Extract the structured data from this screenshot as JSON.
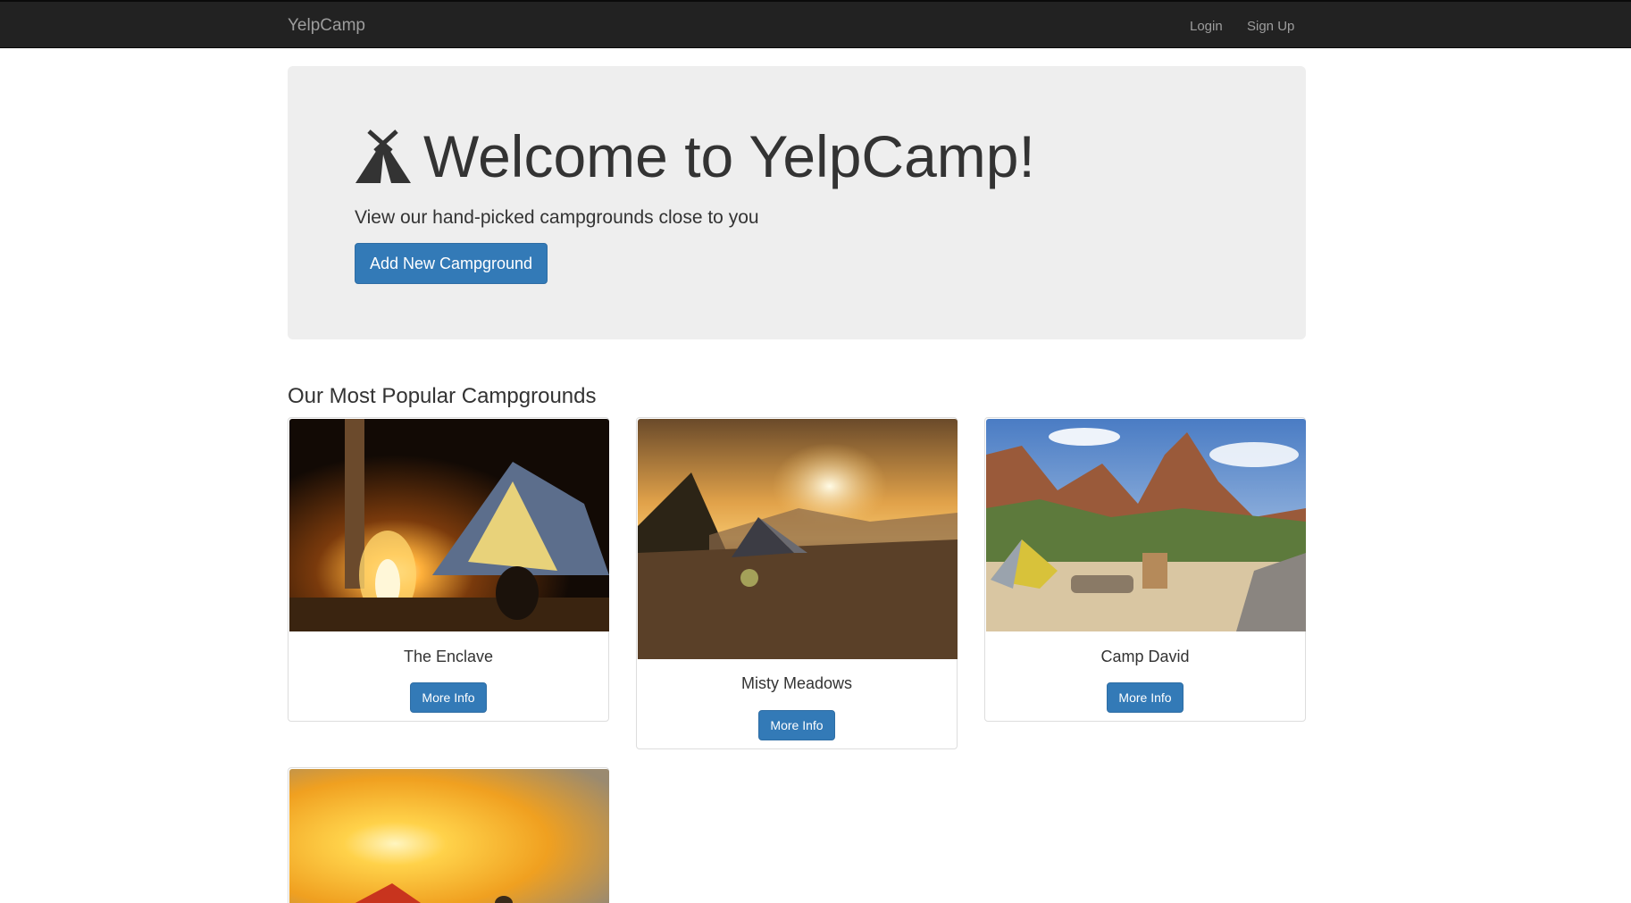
{
  "navbar": {
    "brand": "YelpCamp",
    "links": [
      {
        "label": "Login"
      },
      {
        "label": "Sign Up"
      }
    ]
  },
  "hero": {
    "icon": "tent-icon",
    "title": "Welcome to YelpCamp!",
    "subtitle": "View our hand-picked campgrounds close to you",
    "add_button": "Add New Campground"
  },
  "section": {
    "title": "Our Most Popular Campgrounds"
  },
  "campgrounds": [
    {
      "name": "The Enclave",
      "button": "More Info"
    },
    {
      "name": "Misty Meadows",
      "button": "More Info"
    },
    {
      "name": "Camp David",
      "button": "More Info"
    },
    {
      "name": "",
      "button": ""
    }
  ],
  "colors": {
    "navbar_bg": "#222222",
    "jumbotron_bg": "#eeeeee",
    "primary": "#337ab7"
  }
}
